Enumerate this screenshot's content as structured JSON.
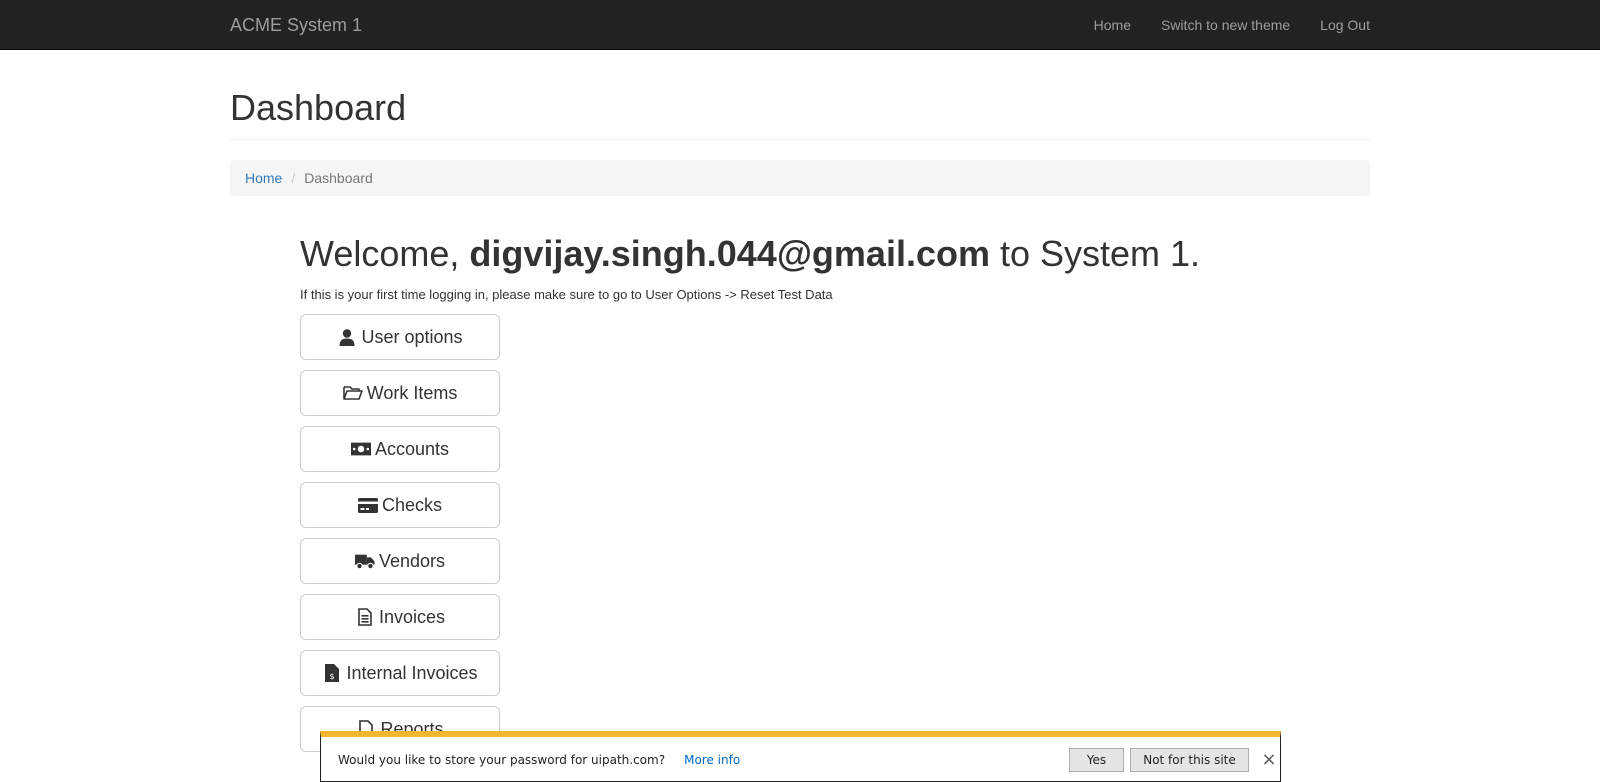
{
  "navbar": {
    "brand": "ACME System 1",
    "links": [
      {
        "label": "Home"
      },
      {
        "label": "Switch to new theme"
      },
      {
        "label": "Log Out"
      }
    ]
  },
  "page": {
    "title": "Dashboard"
  },
  "breadcrumb": {
    "home": "Home",
    "separator": "/",
    "current": "Dashboard"
  },
  "welcome": {
    "prefix": "Welcome, ",
    "email": "digvijay.singh.044@gmail.com",
    "suffix": " to System 1.",
    "hint": "If this is your first time logging in, please make sure to go to User Options -> Reset Test Data"
  },
  "menu_buttons": [
    {
      "label": "User options",
      "icon": "user-icon"
    },
    {
      "label": "Work Items",
      "icon": "folder-open-icon"
    },
    {
      "label": "Accounts",
      "icon": "money-icon"
    },
    {
      "label": "Checks",
      "icon": "credit-card-icon"
    },
    {
      "label": "Vendors",
      "icon": "truck-icon"
    },
    {
      "label": "Invoices",
      "icon": "file-text-icon"
    },
    {
      "label": "Internal Invoices",
      "icon": "file-invoice-dollar-icon"
    },
    {
      "label": "Reports",
      "icon": "file-icon"
    }
  ],
  "password_bar": {
    "message": "Would you like to store your password for uipath.com?",
    "more_info": "More info",
    "yes": "Yes",
    "not_for_site": "Not for this site",
    "close": "×",
    "accent_color": "#f2b632"
  }
}
